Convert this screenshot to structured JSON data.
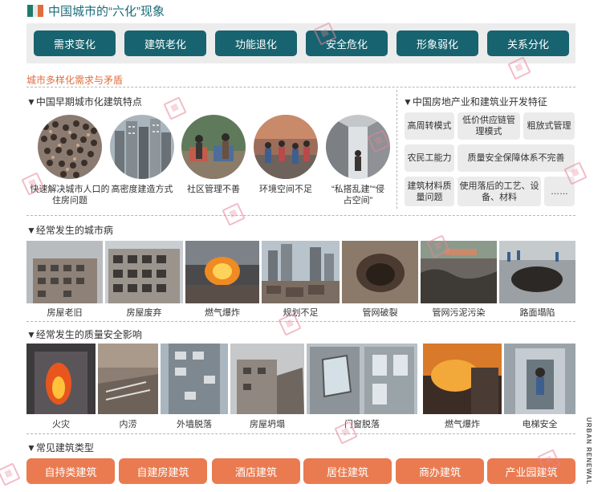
{
  "header": {
    "title": "中国城市的“六化”现象",
    "flag_colors": [
      "#1d7a6c",
      "#e8e8e8",
      "#e06d3c"
    ]
  },
  "phenomena": [
    "需求变化",
    "建筑老化",
    "功能退化",
    "安全危化",
    "形象弱化",
    "关系分化"
  ],
  "subtitle": "城市多样化需求与矛盾",
  "early_urbanization": {
    "heading": "▼中国早期城市化建筑特点",
    "items": [
      {
        "label": "快速解决城市人口的住房问题",
        "icon": "crowd-photo"
      },
      {
        "label": "高密度建造方式",
        "icon": "highrise-photo"
      },
      {
        "label": "社区管理不善",
        "icon": "street-market-photo"
      },
      {
        "label": "环境空间不足",
        "icon": "crowded-street-photo"
      },
      {
        "label": "“私搭乱建”“侵占空间”",
        "icon": "alley-photo"
      }
    ]
  },
  "real_estate": {
    "heading": "▼中国房地产业和建筑业开发特征",
    "cells": [
      "高周转模式",
      "低价供应链管理模式",
      "粗放式管理",
      "农民工能力",
      "质量安全保障体系不完善",
      "建筑材料质量问题",
      "使用落后的工艺、设备、材料",
      "……"
    ]
  },
  "urban_diseases": {
    "heading": "▼经常发生的城市病",
    "items": [
      "房屋老旧",
      "房屋废弃",
      "燃气爆炸",
      "规划不足",
      "管网破裂",
      "管网污泥污染",
      "路面塌陷"
    ]
  },
  "quality_safety": {
    "heading": "▼经常发生的质量安全影响",
    "items": [
      "火灾",
      "内涝",
      "外墙脱落",
      "房屋坍塌",
      "门窗脱落",
      "燃气爆炸",
      "电梯安全"
    ]
  },
  "building_types": {
    "heading": "▼常见建筑类型",
    "items": [
      "自持类建筑",
      "自建房建筑",
      "酒店建筑",
      "居住建筑",
      "商办建筑",
      "产业园建筑"
    ]
  },
  "side_label": "URBAN RENEWAL",
  "colors": {
    "teal": "#17636f",
    "orange": "#ea7b50",
    "accent_text": "#e06d3c"
  }
}
